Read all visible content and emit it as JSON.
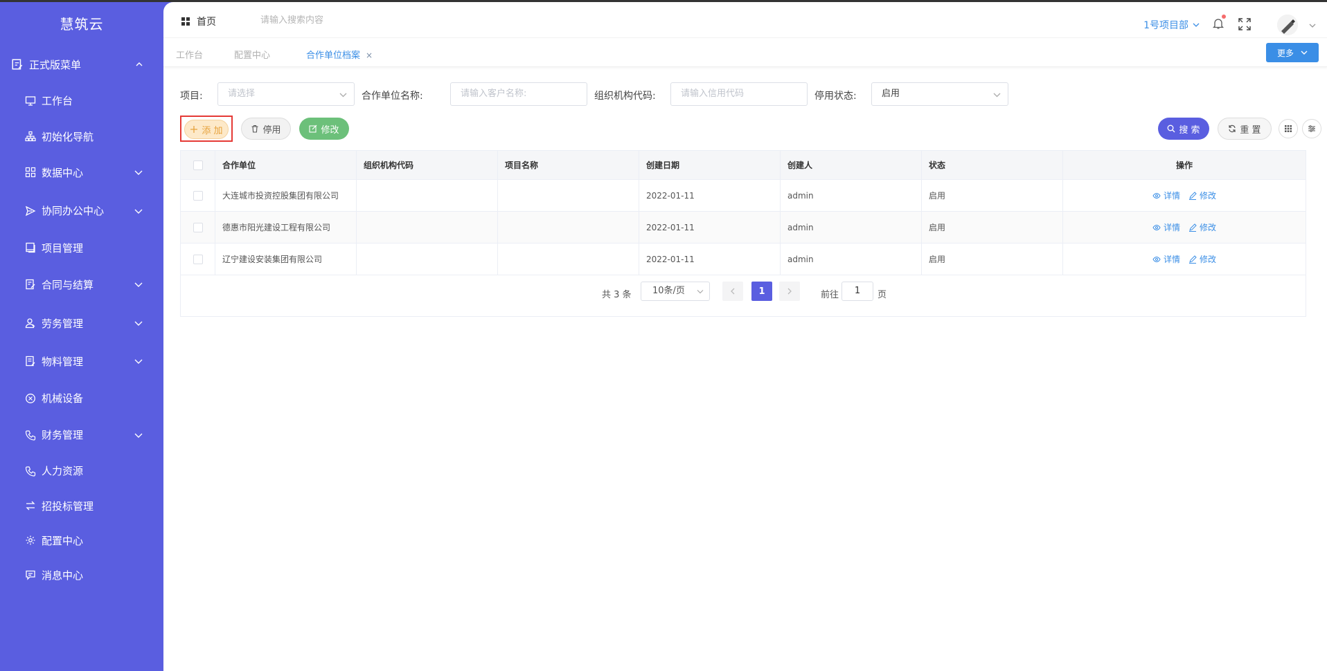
{
  "brand": "慧筑云",
  "sidebar": {
    "group_label": "正式版菜单",
    "items": [
      {
        "label": "工作台",
        "icon": "monitor-icon",
        "has_children": false
      },
      {
        "label": "初始化导航",
        "icon": "sitemap-icon",
        "has_children": false
      },
      {
        "label": "数据中心",
        "icon": "grid-icon",
        "has_children": true
      },
      {
        "label": "协同办公中心",
        "icon": "send-icon",
        "has_children": true
      },
      {
        "label": "项目管理",
        "icon": "book-icon",
        "has_children": false
      },
      {
        "label": "合同与结算",
        "icon": "contract-icon",
        "has_children": true
      },
      {
        "label": "劳务管理",
        "icon": "worker-icon",
        "has_children": true
      },
      {
        "label": "物料管理",
        "icon": "material-icon",
        "has_children": true
      },
      {
        "label": "机械设备",
        "icon": "circle-x-icon",
        "has_children": false
      },
      {
        "label": "财务管理",
        "icon": "phone-icon",
        "has_children": true
      },
      {
        "label": "人力资源",
        "icon": "phone-icon",
        "has_children": false
      },
      {
        "label": "招投标管理",
        "icon": "exchange-icon",
        "has_children": false
      },
      {
        "label": "配置中心",
        "icon": "gear-icon",
        "has_children": false
      },
      {
        "label": "消息中心",
        "icon": "message-icon",
        "has_children": false
      }
    ]
  },
  "header": {
    "home_label": "首页",
    "search_placeholder": "请输入搜索内容",
    "project_label": "1号项目部"
  },
  "tabs": {
    "items": [
      "工作台",
      "配置中心",
      "合作单位档案"
    ],
    "active_index": 2,
    "more_label": "更多"
  },
  "filters": {
    "project_label": "项目:",
    "project_placeholder": "请选择",
    "partner_label": "合作单位名称:",
    "partner_placeholder": "请输入客户名称:",
    "org_label": "组织机构代码:",
    "org_placeholder": "请输入信用代码",
    "status_label": "停用状态:",
    "status_value": "启用"
  },
  "toolbar": {
    "add_label": "添 加",
    "disable_label": "停用",
    "edit_label": "修改",
    "search_label": "搜 索",
    "reset_label": "重 置"
  },
  "table": {
    "columns": [
      "合作单位",
      "组织机构代码",
      "项目名称",
      "创建日期",
      "创建人",
      "状态",
      "操作"
    ],
    "rows": [
      {
        "partner": "大连城市投资控股集团有限公司",
        "org_code": "",
        "project": "",
        "date": "2022-01-11",
        "creator": "admin",
        "status": "启用"
      },
      {
        "partner": "德惠市阳光建设工程有限公司",
        "org_code": "",
        "project": "",
        "date": "2022-01-11",
        "creator": "admin",
        "status": "启用"
      },
      {
        "partner": "辽宁建设安装集团有限公司",
        "org_code": "",
        "project": "",
        "date": "2022-01-11",
        "creator": "admin",
        "status": "启用"
      }
    ],
    "action_detail": "详情",
    "action_edit": "修改"
  },
  "pagination": {
    "total_text": "共 3 条",
    "page_size": "10条/页",
    "current_page": "1",
    "goto_label": "前往",
    "goto_value": "1",
    "page_suffix": "页"
  },
  "colors": {
    "sidebar_bg": "#5a5ee0",
    "accent_blue": "#3a8ee6",
    "add_highlight_border": "#e53935",
    "edit_green": "#6cc07a"
  }
}
